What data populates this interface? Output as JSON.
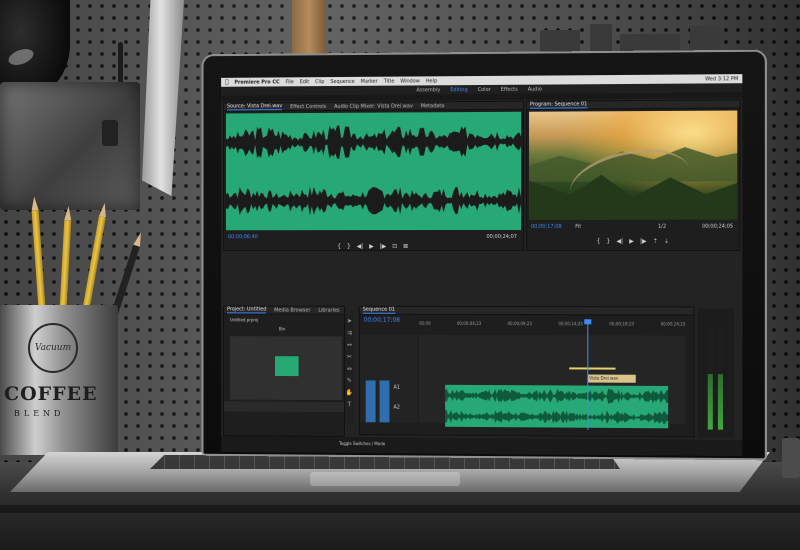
{
  "menubar": {
    "apple": "",
    "app_name": "Premiere Pro CC",
    "items": [
      "File",
      "Edit",
      "Clip",
      "Sequence",
      "Marker",
      "Title",
      "Window",
      "Help"
    ],
    "clock": "Wed 3:12 PM"
  },
  "workspaces": [
    {
      "label": "Assembly",
      "active": false
    },
    {
      "label": "Editing",
      "active": true
    },
    {
      "label": "Color",
      "active": false
    },
    {
      "label": "Effects",
      "active": false
    },
    {
      "label": "Audio",
      "active": false
    }
  ],
  "source_panel": {
    "tabs": [
      "Source: Vista Drei.wav",
      "Effect Controls",
      "Audio Clip Mixer: Vista Drei.wav",
      "Metadata"
    ],
    "timecode_left": "00;00;06;40",
    "timecode_right": "00;00;24;07"
  },
  "program_panel": {
    "tab": "Program: Sequence 01",
    "timecode_left": "00;00;17;08",
    "fit": "Fit",
    "zoom": "1/2",
    "timecode_right": "00;00;24;05"
  },
  "project_panel": {
    "tabs": [
      "Project: Untitled",
      "Media Browser",
      "Libraries"
    ],
    "project_file": "Untitled.prproj",
    "bin": "Bin"
  },
  "timeline": {
    "tab": "Sequence 01",
    "timecode": "00;00;17;08",
    "ruler": [
      "00;00",
      "00;00;04;23",
      "00;00;09;23",
      "00;00;14;23",
      "00;00;19;23",
      "00;00;24;23"
    ],
    "clip_label": "Vista Drei.wav",
    "audio_tracks": [
      "A1",
      "A2"
    ]
  },
  "status_bar": {
    "label": "Toggle Switches / Mode"
  },
  "mug": {
    "word_top": "Vacuum",
    "word_main": "COFFEE",
    "word_sub": "BLEND"
  },
  "colors": {
    "accent_blue": "#3d8cff",
    "audio_green": "#27a877",
    "panel_dark": "#1e1e1e"
  }
}
